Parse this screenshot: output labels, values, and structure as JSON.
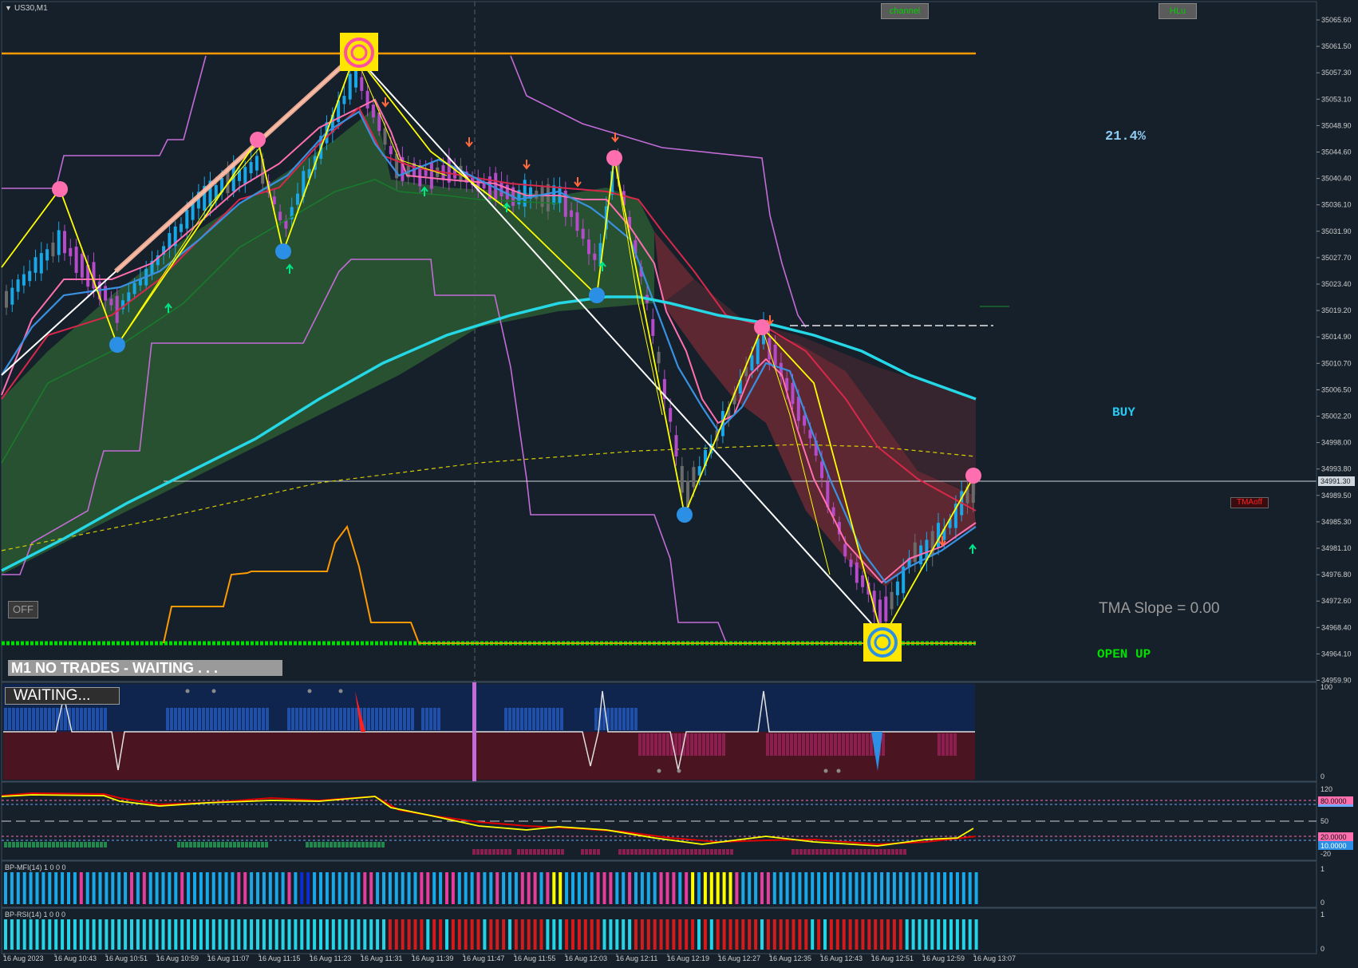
{
  "window": {
    "symbol_label": "US30,M1",
    "menu_glyph": "▼"
  },
  "buttons": {
    "channel": "channel",
    "hlu": "HLu",
    "off": "OFF",
    "tma_off": "TMAoff"
  },
  "status": {
    "banner": "M1  NO TRADES - WAITING . . .",
    "waiting": "WAITING...",
    "percent": "21.4%",
    "signal": "BUY",
    "tma_slope": "TMA Slope = 0.00",
    "open_direction": "OPEN UP"
  },
  "price_axis": {
    "ticks": [
      "35065.60",
      "35061.50",
      "35057.30",
      "35053.10",
      "35048.90",
      "35044.60",
      "35040.40",
      "35036.10",
      "35031.90",
      "35027.70",
      "35023.40",
      "35019.20",
      "35014.90",
      "35010.70",
      "35006.50",
      "35002.20",
      "34998.00",
      "34993.80",
      "34989.50",
      "34985.30",
      "34981.10",
      "34976.80",
      "34972.60",
      "34968.40",
      "34964.10",
      "34959.90"
    ],
    "current_price": "34991.30"
  },
  "time_axis": [
    "16 Aug 2023",
    "16 Aug 10:43",
    "16 Aug 10:51",
    "16 Aug 10:59",
    "16 Aug 11:07",
    "16 Aug 11:15",
    "16 Aug 11:23",
    "16 Aug 11:31",
    "16 Aug 11:39",
    "16 Aug 11:47",
    "16 Aug 11:55",
    "16 Aug 12:03",
    "16 Aug 12:11",
    "16 Aug 12:19",
    "16 Aug 12:27",
    "16 Aug 12:35",
    "16 Aug 12:43",
    "16 Aug 12:51",
    "16 Aug 12:59",
    "16 Aug 13:07"
  ],
  "sub_panels": {
    "trend": {
      "top": "100",
      "bottom": "0"
    },
    "oscillator": {
      "ticks": [
        "120",
        "50",
        "-20"
      ],
      "upper_level": "80.0000",
      "lower_level": "20.0000",
      "current_value": "10.0000"
    },
    "mfi": {
      "label": "BP-MFI(14) 1 0 0 0",
      "top": "1",
      "bottom": "0"
    },
    "rsi": {
      "label": "BP-RSI(14) 1 0 0 0",
      "top": "1",
      "bottom": "0"
    }
  },
  "colors": {
    "background": "#15202b",
    "orange": "#ff9900",
    "cyan": "#26d7e6",
    "magenta": "#c36bd6",
    "yellow": "#ffff00",
    "bull_candle": "#1aa7e8",
    "bear_candle": "#b54bc9",
    "green_text": "#00e000",
    "buy_text": "#27c9f0",
    "pink_marker": "#ff6fb0",
    "blue_marker": "#2b8fe6"
  }
}
